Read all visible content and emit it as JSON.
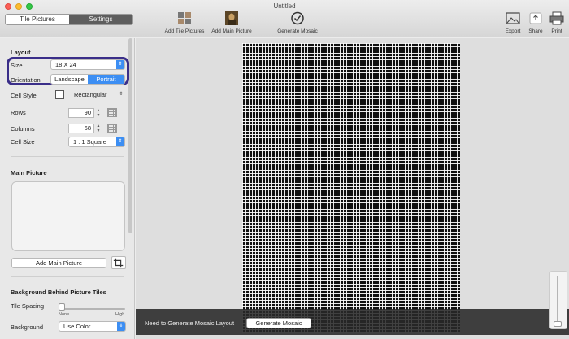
{
  "window": {
    "title": "Untitled"
  },
  "tabs": [
    {
      "label": "Tile Pictures",
      "active": true
    },
    {
      "label": "Settings",
      "active": false
    }
  ],
  "toolbar": {
    "add_tiles": "Add Tile Pictures",
    "add_main": "Add Main Picture",
    "generate": "Generate Mosaic",
    "export": "Export",
    "share": "Share",
    "print": "Print"
  },
  "layout": {
    "heading": "Layout",
    "size_label": "Size",
    "size_value": "18 X 24",
    "orientation_label": "Orientation",
    "orientation_options": [
      "Landscape",
      "Portrait"
    ],
    "orientation_selected": "Portrait",
    "cell_style_label": "Cell Style",
    "cell_style_value": "Rectangular",
    "rows_label": "Rows",
    "rows_value": "90",
    "columns_label": "Columns",
    "columns_value": "68",
    "cell_size_label": "Cell Size",
    "cell_size_value": "1 : 1 Square"
  },
  "main_picture": {
    "heading": "Main Picture",
    "add_button": "Add Main Picture"
  },
  "background": {
    "heading": "Background Behind Picture Tiles",
    "tile_spacing_label": "Tile Spacing",
    "tile_spacing_min": "None",
    "tile_spacing_max": "High",
    "tile_spacing_level": 0,
    "background_label": "Background",
    "background_value": "Use Color"
  },
  "canvas": {
    "notice": "Need to Generate Mosaic Layout",
    "generate_button": "Generate Mosaic"
  },
  "colors": {
    "accent": "#3c8ef3",
    "highlight": "#3a2e89"
  }
}
